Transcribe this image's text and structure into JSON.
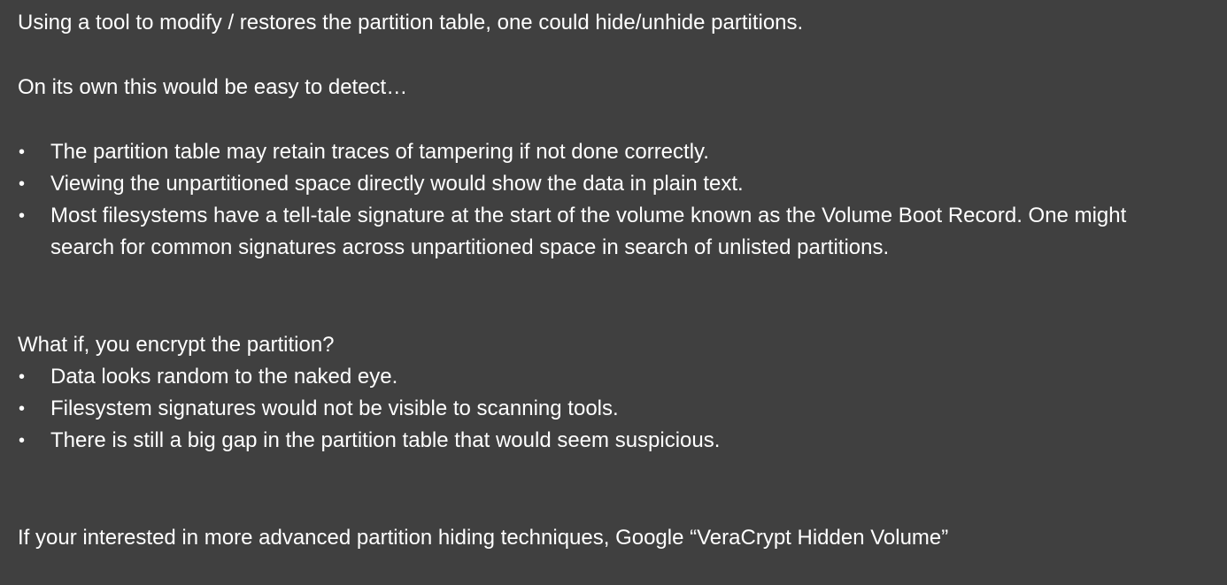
{
  "slide": {
    "intro": "Using a tool to modify / restores the partition table, one could hide/unhide partitions.",
    "detect_heading": "On its own this would be easy to detect…",
    "detect_bullets": [
      "The partition table may retain traces of tampering if not done correctly.",
      "Viewing the unpartitioned space directly would show the data in plain text.",
      "Most filesystems have a tell-tale signature at the start of the volume known as the Volume Boot Record.  One might search for common signatures across unpartitioned space in search of unlisted partitions."
    ],
    "encrypt_heading": "What if, you encrypt the partition?",
    "encrypt_bullets": [
      "Data looks random to the naked eye.",
      "Filesystem signatures would not be visible to scanning tools.",
      "There is still a big gap in the partition table that would seem suspicious."
    ],
    "footer": "If your interested in more advanced partition hiding techniques, Google “VeraCrypt Hidden Volume”",
    "bullet_glyph": "•"
  },
  "colors": {
    "background": "#404040",
    "text": "#ffffff"
  }
}
